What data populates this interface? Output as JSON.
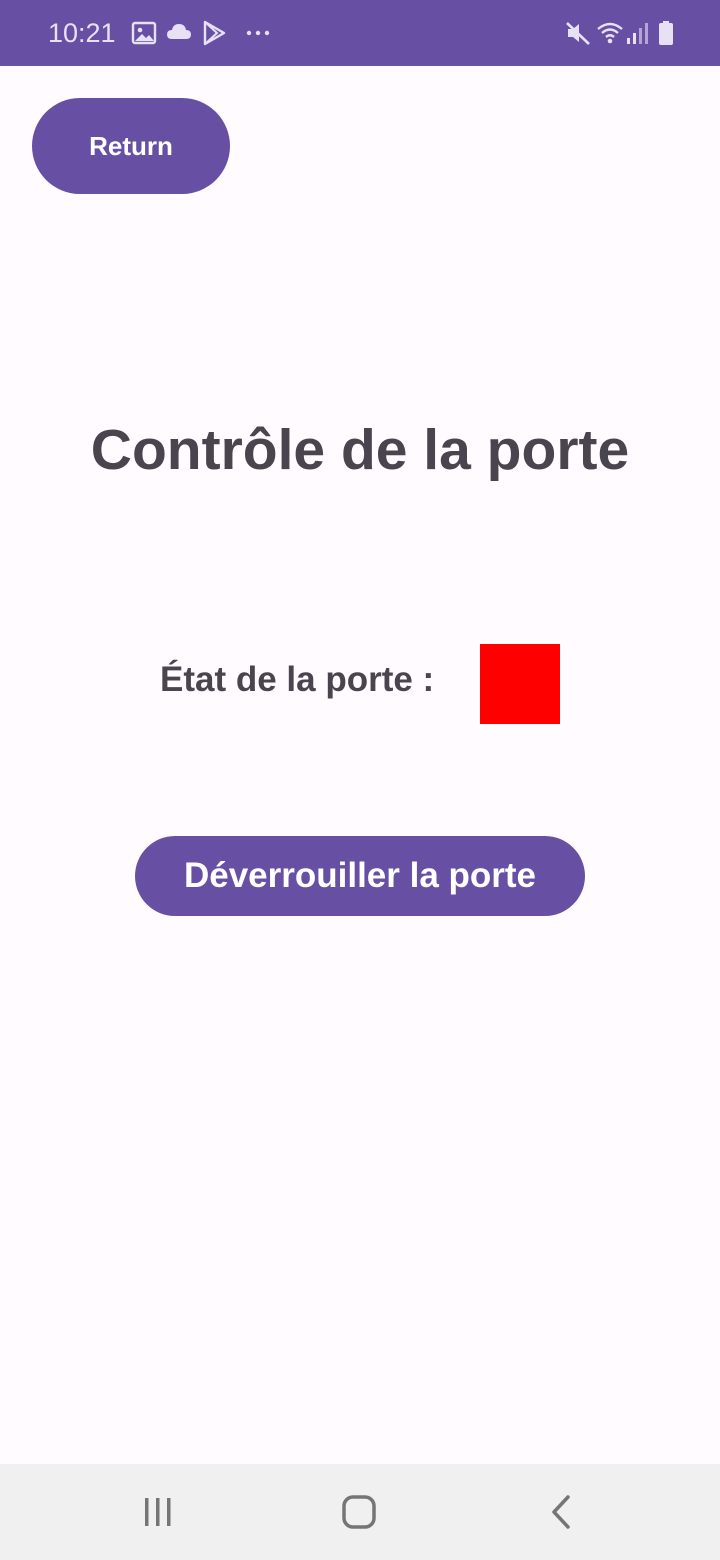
{
  "status_bar": {
    "time": "10:21",
    "left_icons": [
      "gallery-icon",
      "cloud-icon",
      "play-store-icon",
      "more-dots-icon"
    ],
    "right_icons": [
      "mute-icon",
      "wifi-icon",
      "signal-icon",
      "battery-icon"
    ]
  },
  "header": {
    "return_label": "Return"
  },
  "main": {
    "title": "Contrôle de la porte",
    "door_state_label": "État de la porte :",
    "door_state_color": "#FF0000",
    "unlock_label": "Déverrouiller la porte"
  },
  "navigation_bar": {
    "buttons": [
      "recent-apps-icon",
      "home-icon",
      "back-icon"
    ]
  },
  "colors": {
    "primary": "#6750A4",
    "background": "#FFFBFE",
    "text": "#49454F",
    "nav_background": "#F0F0F0"
  }
}
